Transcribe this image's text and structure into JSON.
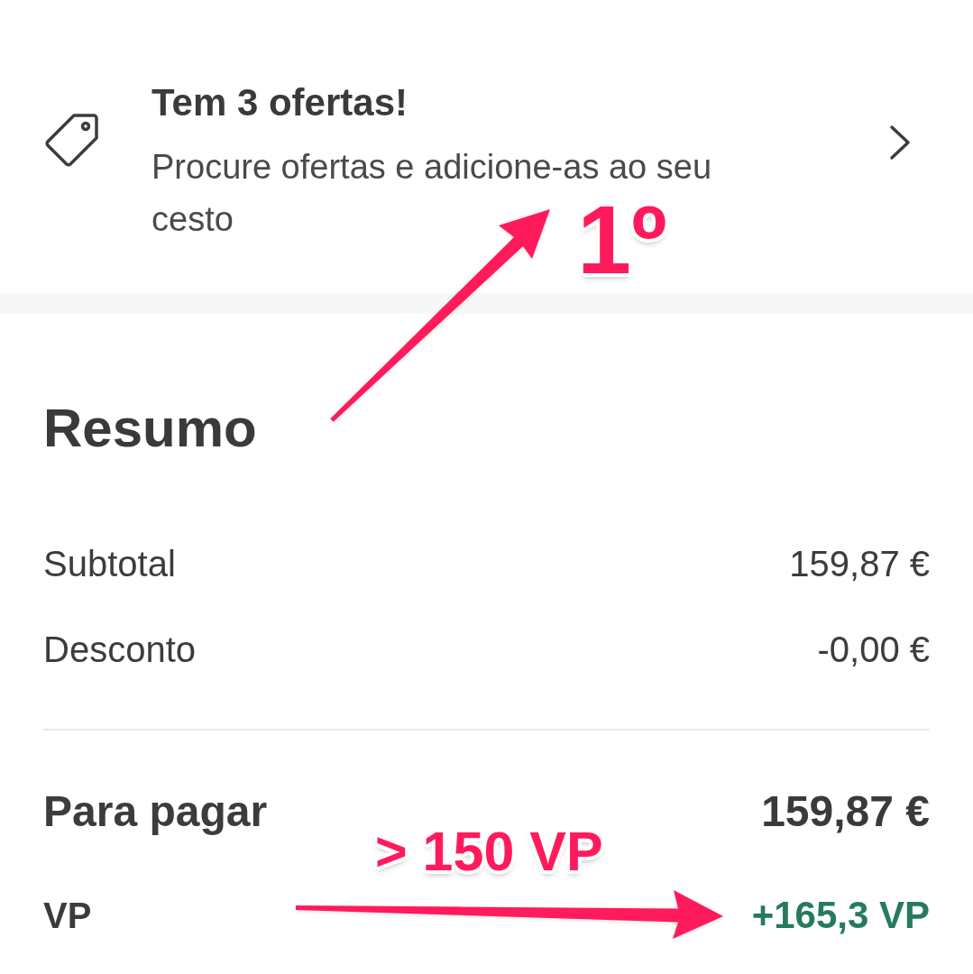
{
  "offers": {
    "title": "Tem 3 ofertas!",
    "description": "Procure ofertas e adicione-as ao seu cesto"
  },
  "summary": {
    "title": "Resumo",
    "rows": [
      {
        "kind": "line",
        "label": "Subtotal",
        "value": "159,87 €"
      },
      {
        "kind": "line",
        "label": "Desconto",
        "value": "-0,00 €"
      },
      {
        "kind": "total",
        "label": "Para pagar",
        "value": "159,87 €"
      },
      {
        "kind": "points",
        "label": "VP",
        "value": "+165,3 VP"
      }
    ]
  },
  "annotations": [
    {
      "kind": "order",
      "text": "1º"
    },
    {
      "kind": "threshold",
      "text": "> 150 VP"
    }
  ]
}
